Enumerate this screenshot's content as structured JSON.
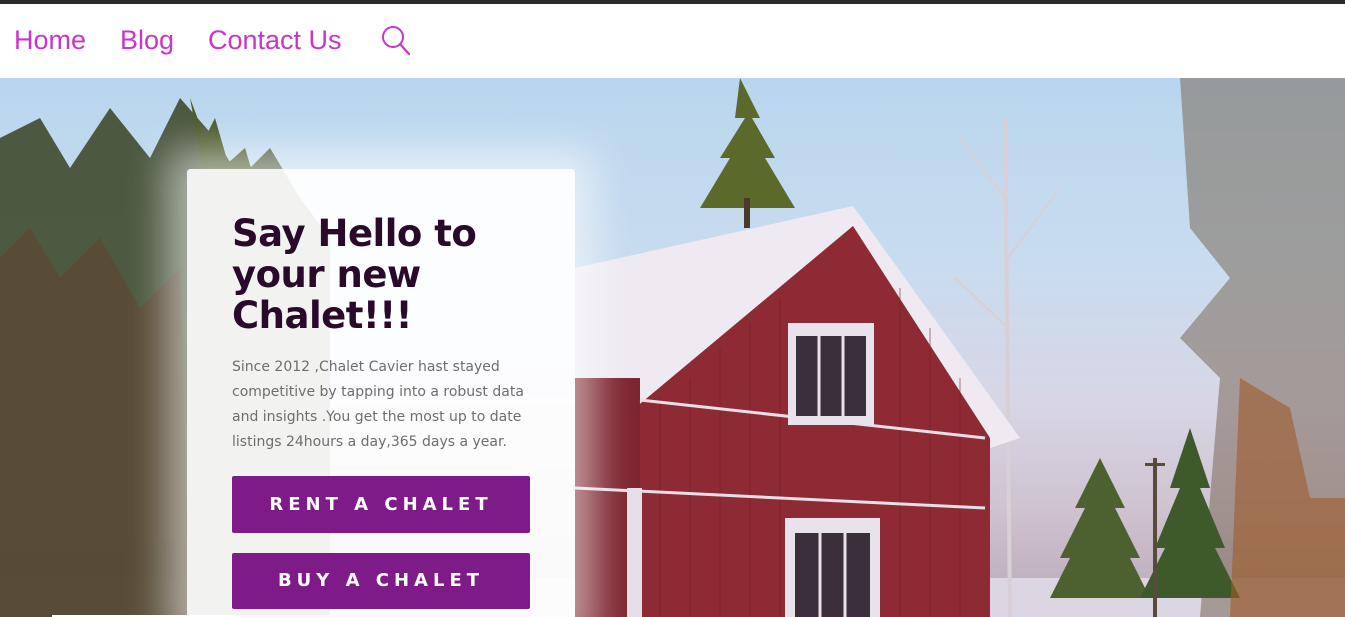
{
  "nav": {
    "items": [
      {
        "label": "Home"
      },
      {
        "label": "Blog"
      },
      {
        "label": "Contact Us"
      }
    ],
    "search_icon": "search-icon",
    "link_color": "#cc33cc"
  },
  "hero": {
    "title": "Say Hello to your new Chalet!!!",
    "description": "Since 2012 ,Chalet Cavier hast stayed competitive by tapping into a robust data and insights .You get the most up to date listings 24hours a day,365 days a year.",
    "rent_button": "RENT A CHALET",
    "buy_button": "BUY A CHALET",
    "button_color": "#7f1a89",
    "title_color": "#2a0a2a"
  }
}
